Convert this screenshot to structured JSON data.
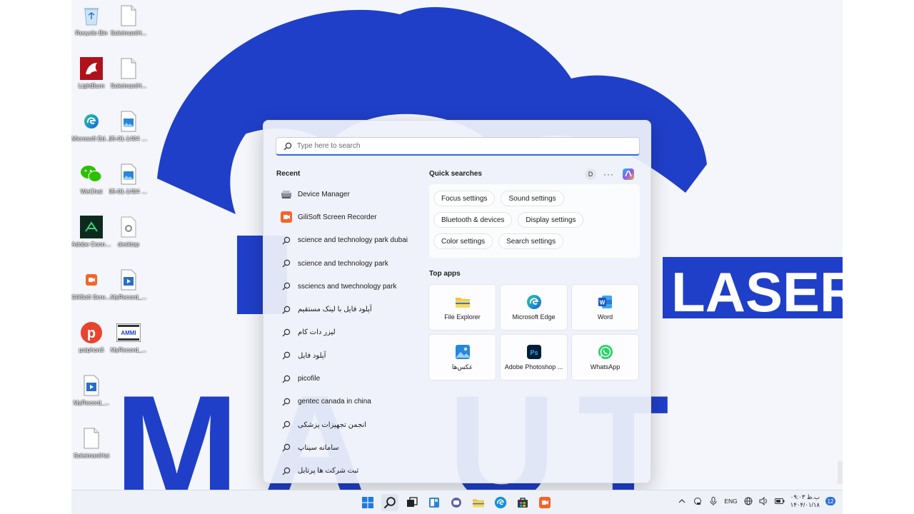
{
  "desktop": {
    "icons": [
      {
        "label": "Recycle Bin",
        "icon": "recycle-bin-icon"
      },
      {
        "label": "SoleimaniH...",
        "icon": "file-icon"
      },
      {
        "label": "LightBurn",
        "icon": "lightburn-icon"
      },
      {
        "label": "SoleimaniH...",
        "icon": "file-icon"
      },
      {
        "label": "Microsoft Edge",
        "icon": "edge-icon"
      },
      {
        "label": "تصویر واتساپ 1404-01-05 ...",
        "icon": "image-file-icon"
      },
      {
        "label": "WeChat",
        "icon": "wechat-icon"
      },
      {
        "label": "تصویر واتساپ 1404-01-05 ...",
        "icon": "image-file-icon"
      },
      {
        "label": "Adobe Connect",
        "icon": "adobe-connect-icon"
      },
      {
        "label": "desktop",
        "icon": "settings-file-icon"
      },
      {
        "label": "GiliSoft Screen ...",
        "icon": "gilisoft-icon"
      },
      {
        "label": "MyRecord_...",
        "icon": "video-file-icon"
      },
      {
        "label": "psiphon3",
        "icon": "psiphon-icon"
      },
      {
        "label": "MyRecord_...",
        "icon": "video-thumb-icon"
      },
      {
        "label": "MyRecord_...",
        "icon": "video-file-icon"
      },
      {
        "label": "SoleimaniHai",
        "icon": "file-icon"
      }
    ]
  },
  "start_menu": {
    "search": {
      "placeholder": "Type here to search",
      "value": ""
    },
    "recent": {
      "title": "Recent",
      "items": [
        {
          "label": "Device Manager",
          "icon": "device-manager-icon"
        },
        {
          "label": "GiliSoft Screen Recorder",
          "icon": "gilisoft-icon"
        },
        {
          "label": "science and technology park dubai",
          "icon": "search-icon"
        },
        {
          "label": "science and technology park",
          "icon": "search-icon"
        },
        {
          "label": "ssciencs and twechnology park",
          "icon": "search-icon"
        },
        {
          "label": "آپلود فایل با لینک مستقیم",
          "icon": "search-icon"
        },
        {
          "label": "لیزر دات کام",
          "icon": "search-icon"
        },
        {
          "label": "آپلود فایل",
          "icon": "search-icon"
        },
        {
          "label": "picofile",
          "icon": "search-icon"
        },
        {
          "label": "gentec canada in china",
          "icon": "search-icon"
        },
        {
          "label": "انجمن تجهیزات پزشکی",
          "icon": "search-icon"
        },
        {
          "label": "سامانه سیناپ",
          "icon": "search-icon"
        },
        {
          "label": "ثبت شرکت ها پرتابل",
          "icon": "search-icon"
        }
      ]
    },
    "quick_searches": {
      "title": "Quick searches",
      "avatar": "D",
      "more": "···",
      "chips": [
        [
          "Focus settings",
          "Sound settings"
        ],
        [
          "Bluetooth & devices",
          "Display settings"
        ],
        [
          "Color settings",
          "Search settings"
        ]
      ]
    },
    "top_apps": {
      "title": "Top apps",
      "apps": [
        {
          "label": "File Explorer",
          "icon": "file-explorer-icon"
        },
        {
          "label": "Microsoft Edge",
          "icon": "edge-icon"
        },
        {
          "label": "Word",
          "icon": "word-icon"
        },
        {
          "label": "عکس‌ها",
          "icon": "photos-icon"
        },
        {
          "label": "Adobe Photoshop ...",
          "icon": "photoshop-icon"
        },
        {
          "label": "WhatsApp",
          "icon": "whatsapp-icon"
        }
      ]
    }
  },
  "taskbar": {
    "apps": [
      "start-icon",
      "search-icon",
      "task-view-icon",
      "widgets-icon",
      "teams-icon",
      "file-explorer-icon",
      "edge-icon",
      "store-icon",
      "gilisoft-icon"
    ],
    "tray": {
      "lang": "ENG",
      "time": "۰۹:۰۳ ب.ظ",
      "date": "۱۴۰۴/۰۱/۱۸",
      "notifications": "12"
    }
  },
  "wallpaper": {
    "text_laser": "LASER",
    "text_bottom": "MA UT"
  },
  "colors": {
    "accent": "#2b6fd6",
    "wallpaper_blue": "#1f3fc9"
  }
}
